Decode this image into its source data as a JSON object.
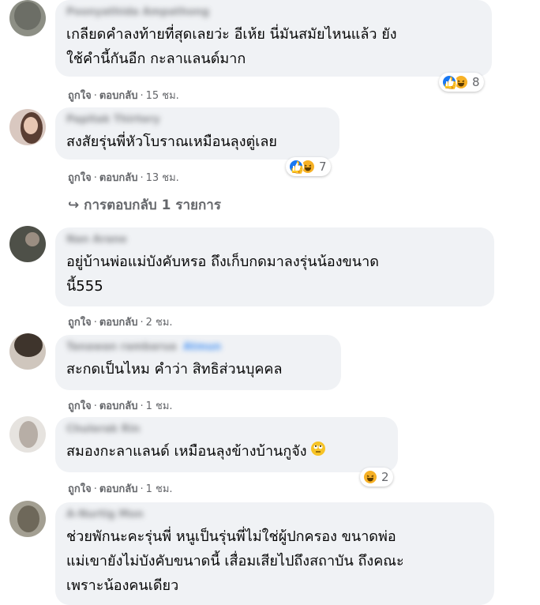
{
  "comments": [
    {
      "name": "Poonyathida Ampathong",
      "text": "เกลียดคำลงท้ายที่สุดเลยว่ะ อีเห้ย นี่มันสมัยไหนแล้ว ยัง\nใช้คำนี้กันอีก กะลาแลนด์มาก",
      "like_label": "ถูกใจ",
      "reply_label": "ตอบกลับ",
      "time": "15 ชม.",
      "reactions": [
        "like",
        "haha"
      ],
      "reaction_count": "8"
    },
    {
      "name": "Papitak Thirtery",
      "text": "สงสัยรุ่นพี่หัวโบราณเหมือนลุงตู่เลย",
      "like_label": "ถูกใจ",
      "reply_label": "ตอบกลับ",
      "time": "13 ชม.",
      "reactions": [
        "like",
        "haha"
      ],
      "reaction_count": "7",
      "replies_link": "↪ การตอบกลับ 1 รายการ"
    },
    {
      "name": "Nan Arane",
      "text": "อยู่บ้านพ่อแม่บังคับหรอ ถึงเก็บกดมาลงรุ่นน้องขนาด\nนี้555",
      "like_label": "ถูกใจ",
      "reply_label": "ตอบกลับ",
      "time": "2 ชม."
    },
    {
      "name": "Tanawan rambarua",
      "tag": "Atmun",
      "text": "สะกดเป็นไหม คำว่า สิทธิส่วนบุคคล",
      "like_label": "ถูกใจ",
      "reply_label": "ตอบกลับ",
      "time": "1 ชม."
    },
    {
      "name": "Chulerak Rin",
      "text": "สมองกะลาแลนด์ เหมือนลุงข้างบ้านกูจัง",
      "like_label": "ถูกใจ",
      "reply_label": "ตอบกลับ",
      "time": "1 ชม.",
      "reactions": [
        "haha"
      ],
      "reaction_count": "2"
    },
    {
      "name": "A-Nurtig Mon",
      "text": "ช่วยพักนะคะรุ่นพี่ หนูเป็นรุ่นพี่ไม่ใช่ผู้ปกครอง ขนาดพ่อ\nแม่เขายังไม่บังคับขนาดนี้ เสื่อมเสียไปถึงสถาบัน ถึงคณะ\nเพราะน้องคนเดียว"
    }
  ],
  "icons": {
    "like": "like-icon",
    "haha": "haha-icon",
    "rolling_eyes": "rolling-eyes-emoji"
  },
  "colors": {
    "bubble": "#f0f2f5",
    "meta_text": "#65676b",
    "like_blue": "#1877f2",
    "haha_yellow": "#f7b125"
  }
}
